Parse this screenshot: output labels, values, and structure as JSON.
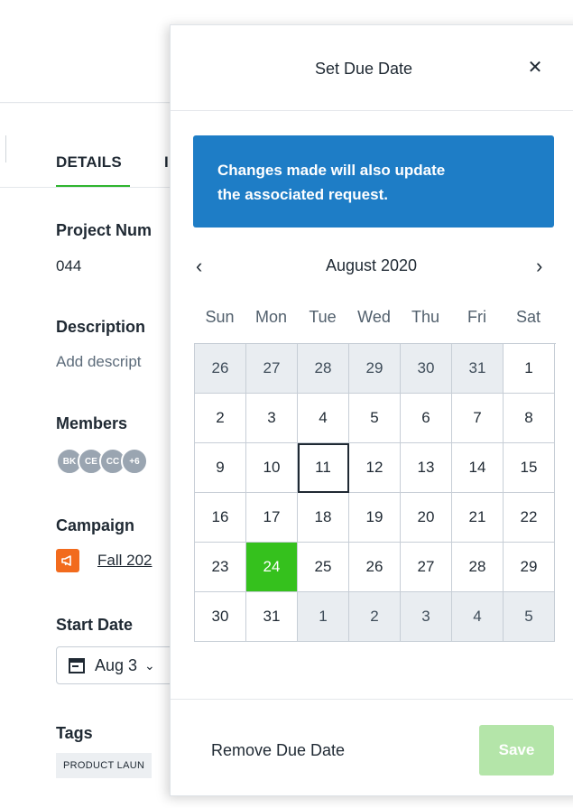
{
  "background": {
    "tabs": [
      "DETAILS",
      "I"
    ],
    "project_number_label": "Project Num",
    "project_number_value": "044",
    "description_label": "Description",
    "description_placeholder": "Add descript",
    "members_label": "Members",
    "members": [
      "BK",
      "CE",
      "CC",
      "+6"
    ],
    "campaign_label": "Campaign",
    "campaign_value": "Fall 202",
    "start_date_label": "Start Date",
    "start_date_value": "Aug 3",
    "tags_label": "Tags",
    "tag_value": "PRODUCT LAUN"
  },
  "modal": {
    "title": "Set Due Date",
    "close_icon": "close-icon",
    "banner_line1": "Changes made will also update",
    "banner_line2": "the associated request.",
    "month_label": "August 2020",
    "weekdays": [
      "Sun",
      "Mon",
      "Tue",
      "Wed",
      "Thu",
      "Fri",
      "Sat"
    ],
    "weeks": [
      [
        "26",
        "27",
        "28",
        "29",
        "30",
        "31",
        "1"
      ],
      [
        "2",
        "3",
        "4",
        "5",
        "6",
        "7",
        "8"
      ],
      [
        "9",
        "10",
        "11",
        "12",
        "13",
        "14",
        "15"
      ],
      [
        "16",
        "17",
        "18",
        "19",
        "20",
        "21",
        "22"
      ],
      [
        "23",
        "24",
        "25",
        "26",
        "27",
        "28",
        "29"
      ],
      [
        "30",
        "31",
        "1",
        "2",
        "3",
        "4",
        "5"
      ]
    ],
    "today": "11",
    "selected": "24",
    "remove_label": "Remove Due Date",
    "save_label": "Save"
  },
  "colors": {
    "accent_green": "#35c11d",
    "banner_blue": "#1e7dc6",
    "save_disabled": "#b4e5a9",
    "campaign_orange": "#f26b1d"
  }
}
